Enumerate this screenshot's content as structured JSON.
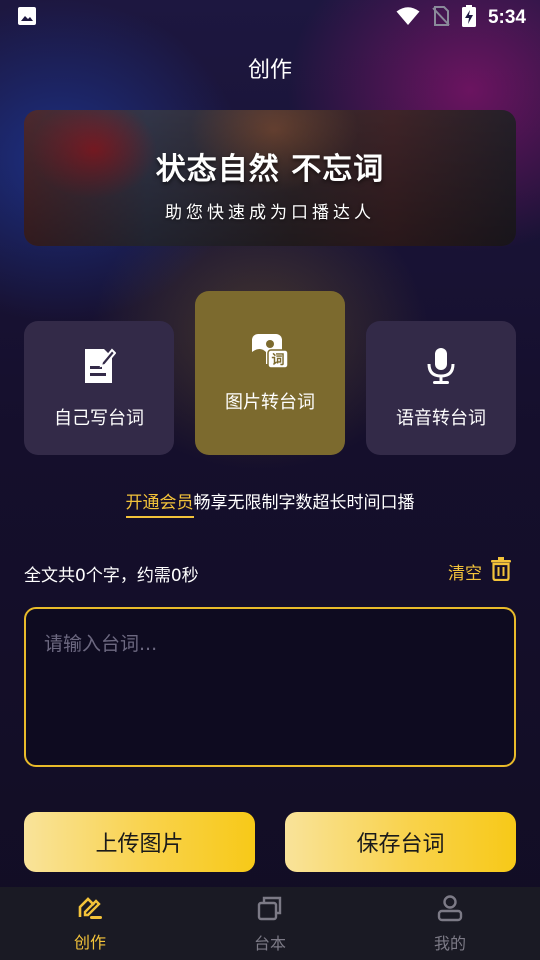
{
  "status_bar": {
    "time": "5:34",
    "icons": [
      "image-icon",
      "wifi-icon",
      "no-sim-icon",
      "battery-charging-icon"
    ]
  },
  "header": {
    "title": "创作"
  },
  "banner": {
    "headline": "状态自然  不忘词",
    "subtitle": "助您快速成为口播达人"
  },
  "modes": [
    {
      "label": "自己写台词",
      "icon": "write-document-icon",
      "active": false
    },
    {
      "label": "图片转台词",
      "icon": "image-to-text-icon",
      "active": true
    },
    {
      "label": "语音转台词",
      "icon": "microphone-icon",
      "active": false
    }
  ],
  "vip": {
    "link_text": "开通会员",
    "text": "畅享无限制字数超长时间口播"
  },
  "stats": {
    "summary": "全文共0个字，约需0秒"
  },
  "clear": {
    "label": "清空",
    "icon": "trash-icon"
  },
  "editor": {
    "value": "",
    "placeholder": "请输入台词..."
  },
  "actions": {
    "upload_label": "上传图片",
    "save_label": "保存台词"
  },
  "bottom_nav": [
    {
      "label": "创作",
      "icon": "create-icon",
      "active": true
    },
    {
      "label": "台本",
      "icon": "scripts-icon",
      "active": false
    },
    {
      "label": "我的",
      "icon": "profile-icon",
      "active": false
    }
  ],
  "colors": {
    "accent": "#f3c33a",
    "card": "#332a48",
    "card_active": "#7c6a2e",
    "nav_bg": "#1a1a24"
  }
}
